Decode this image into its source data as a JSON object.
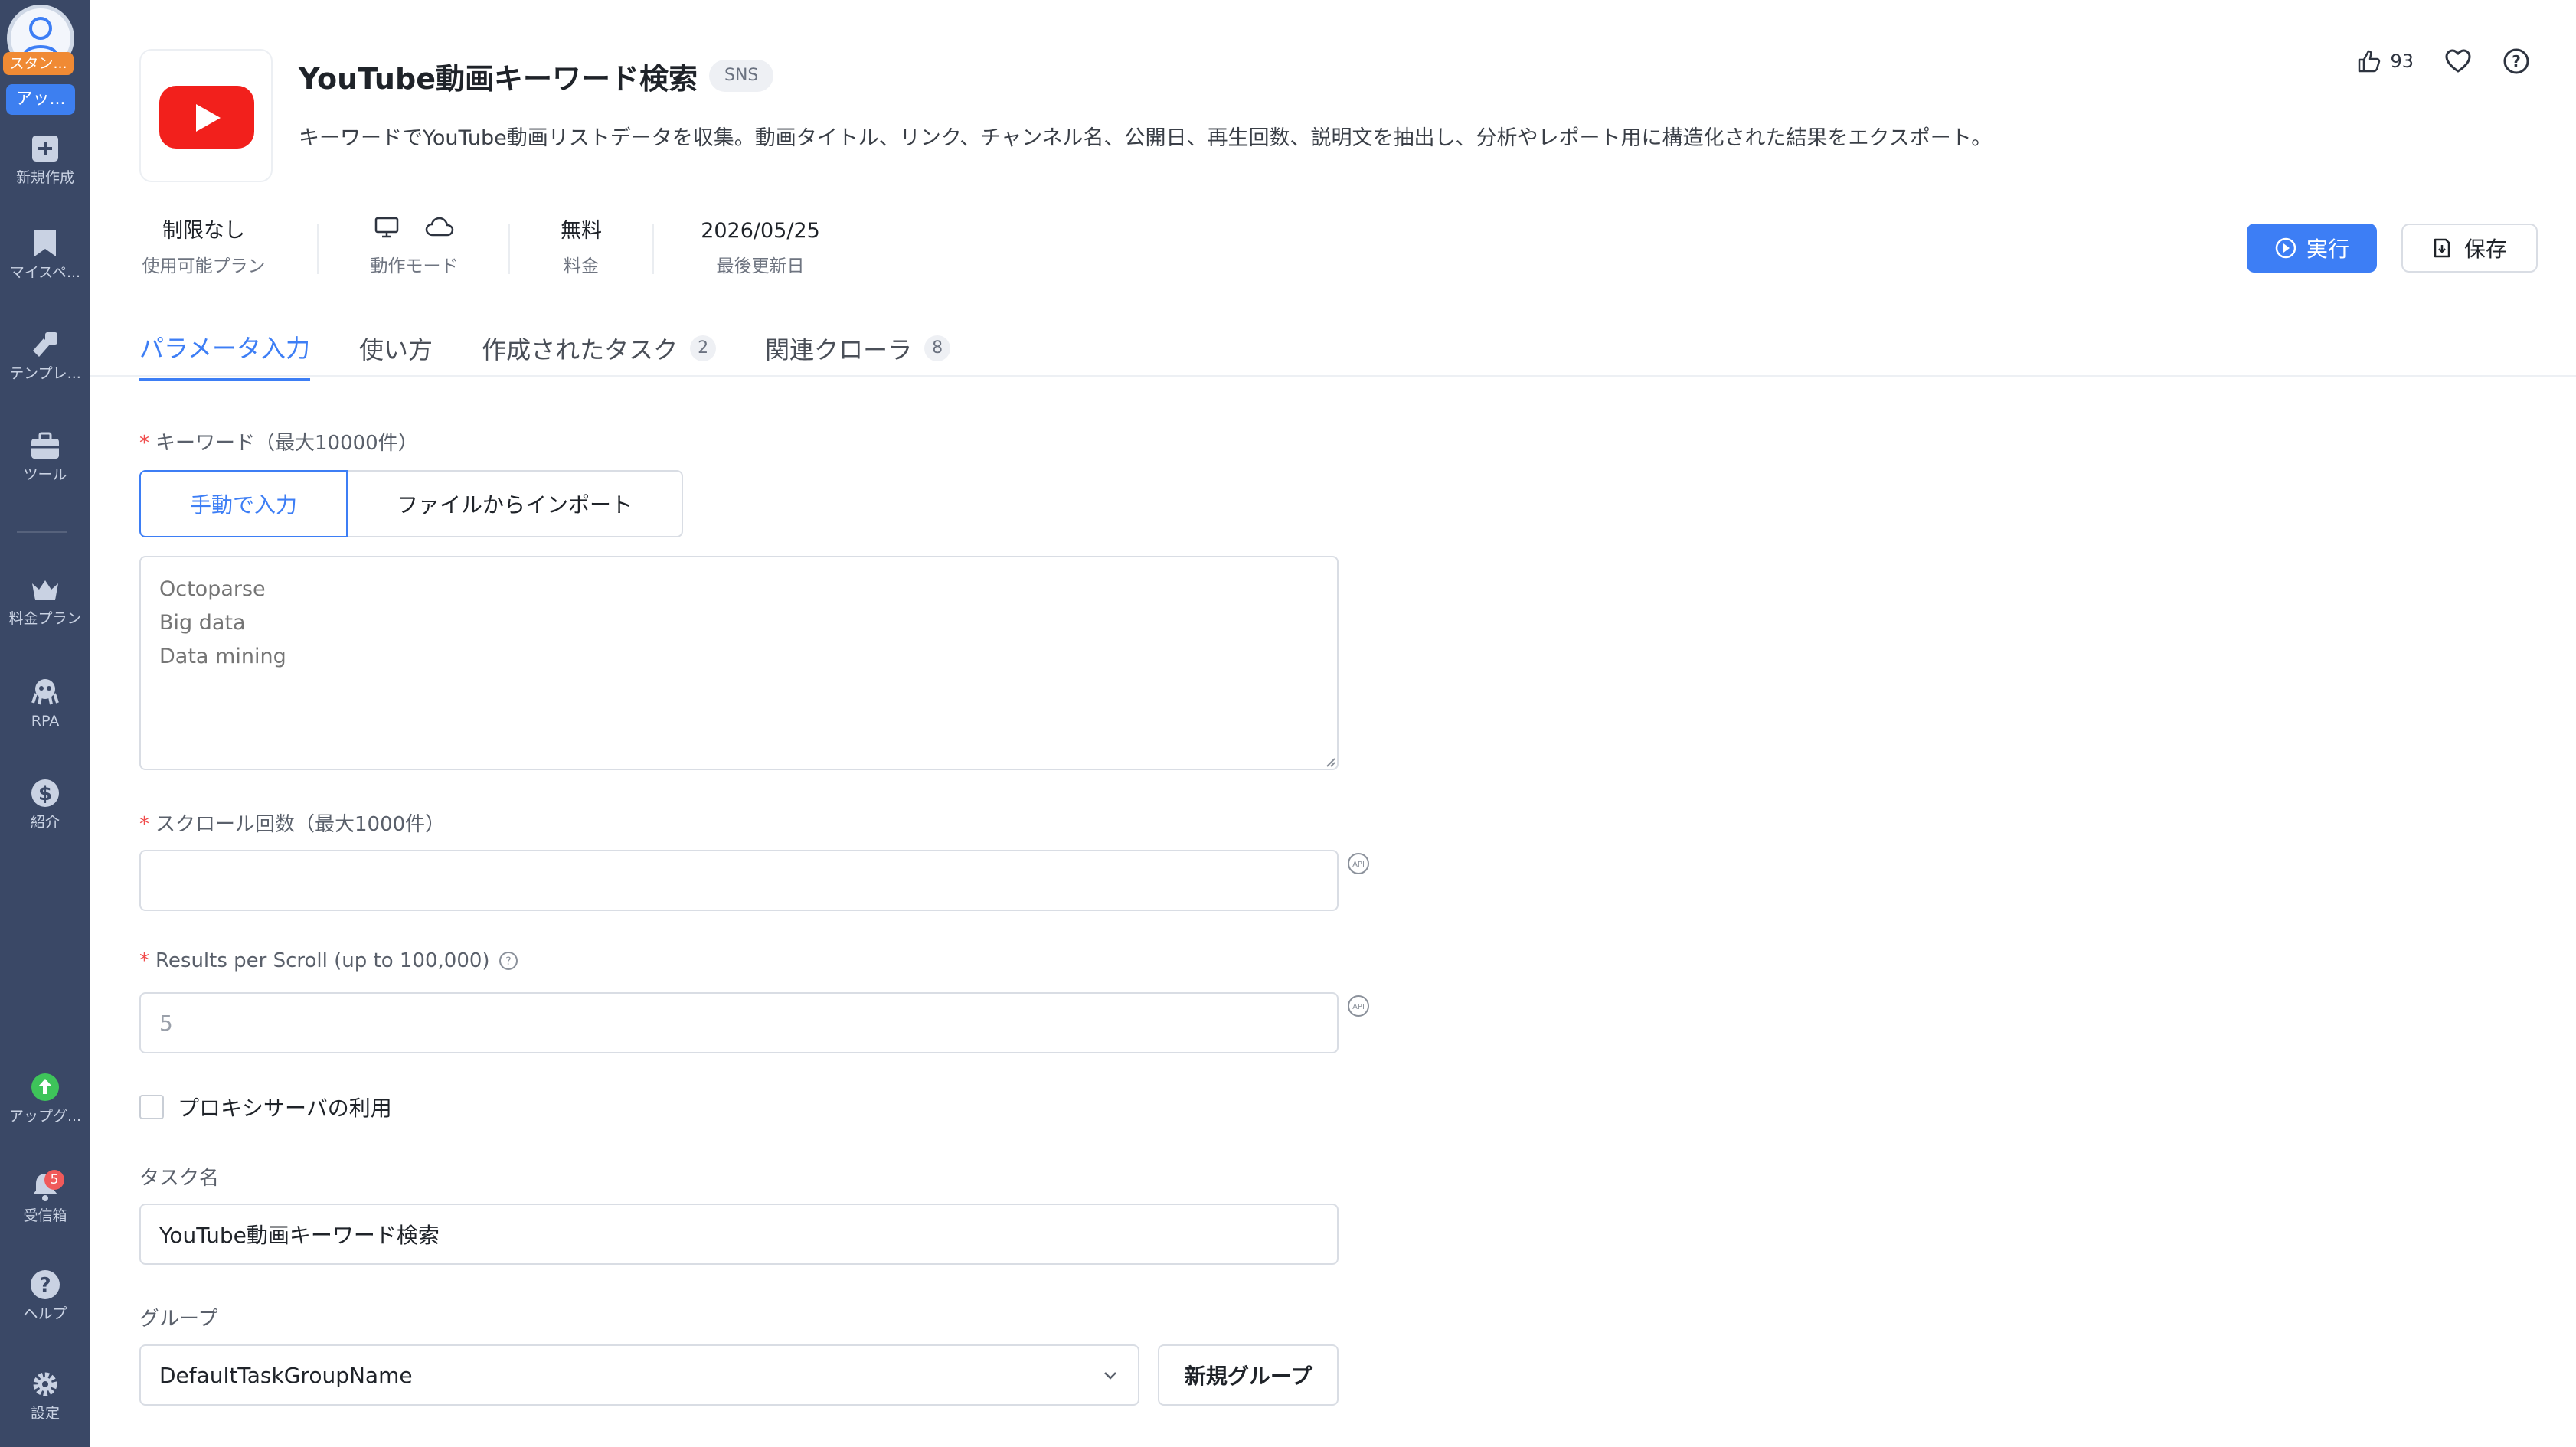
{
  "sidebar": {
    "plan_tag": "スタン...",
    "app_tag": "アッ...",
    "items": [
      {
        "label": "新規作成",
        "icon": "plus-square-icon"
      },
      {
        "label": "マイスペ...",
        "icon": "bookmark-icon"
      },
      {
        "label": "テンプレ...",
        "icon": "template-icon"
      },
      {
        "label": "ツール",
        "icon": "toolbox-icon"
      },
      {
        "label": "料金プラン",
        "icon": "crown-icon"
      },
      {
        "label": "RPA",
        "icon": "robot-icon"
      },
      {
        "label": "紹介",
        "icon": "dollar-icon"
      },
      {
        "label": "アップグ...",
        "icon": "upgrade-icon"
      },
      {
        "label": "受信箱",
        "icon": "bell-icon",
        "badge": "5"
      },
      {
        "label": "ヘルプ",
        "icon": "help-icon"
      },
      {
        "label": "設定",
        "icon": "gear-icon"
      }
    ]
  },
  "header": {
    "title": "YouTube動画キーワード検索",
    "tag": "SNS",
    "description": "キーワードでYouTube動画リストデータを収集。動画タイトル、リンク、チャンネル名、公開日、再生回数、説明文を抽出し、分析やレポート用に構造化された結果をエクスポート。",
    "like_count": "93"
  },
  "meta": {
    "plan": {
      "value": "制限なし",
      "label": "使用可能プラン"
    },
    "mode": {
      "label": "動作モード"
    },
    "price": {
      "value": "無料",
      "label": "料金"
    },
    "updated": {
      "value": "2026/05/25",
      "label": "最後更新日"
    }
  },
  "actions": {
    "run_label": "実行",
    "save_label": "保存"
  },
  "tabs": [
    {
      "label": "パラメータ入力",
      "count": ""
    },
    {
      "label": "使い方",
      "count": ""
    },
    {
      "label": "作成されたタスク",
      "count": "2"
    },
    {
      "label": "関連クローラ",
      "count": "8"
    }
  ],
  "form": {
    "keyword_label": "キーワード（最大10000件）",
    "manual_input_label": "手動で入力",
    "import_file_label": "ファイルからインポート",
    "keyword_placeholder": "Octoparse\nBig data\nData mining",
    "scroll_label": "スクロール回数（最大1000件）",
    "scroll_value": "",
    "results_label": "Results per Scroll (up to 100,000)",
    "results_placeholder": "5",
    "proxy_label": "プロキシサーバの利用",
    "task_name_label": "タスク名",
    "task_name_value": "YouTube動画キーワード検索",
    "group_label": "グループ",
    "group_value": "DefaultTaskGroupName",
    "new_group_label": "新規グループ"
  },
  "colors": {
    "accent": "#3d7ef5",
    "sidebar": "#3a4866",
    "required": "#f04a4a",
    "youtube": "#f2201c"
  }
}
